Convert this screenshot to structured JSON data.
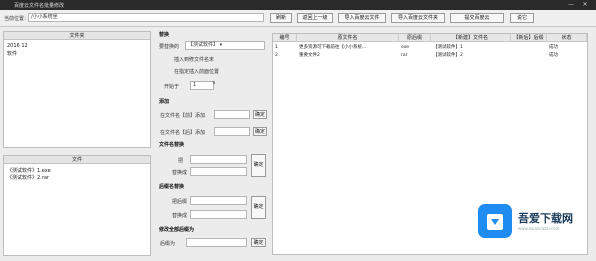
{
  "app": {
    "title": "百度云文件名批量修改"
  },
  "colors": {
    "titlebar": "#2a2a2a",
    "watermark_blue": "#1e8cf0"
  },
  "toolbar": {
    "path_label": "当前位置：",
    "path_value": "/小小系统坐",
    "btn_refresh": "刷新",
    "btn_back": "返回上一级",
    "btn_import_file": "导入百度云文件",
    "btn_import_folder": "导入百度云文件夹",
    "btn_confirm": "提交百度云",
    "btn_about": "说它"
  },
  "folders": {
    "header": "文件夹",
    "items": [
      "2016 12",
      "软件"
    ]
  },
  "files": {
    "header": "文件",
    "items": [
      "《测试软件》1.exe",
      "《测试软件》2.rar"
    ]
  },
  "ops": {
    "section_replace": "替换",
    "replace_mode_label": "要替换的",
    "replace_mode_value": "【测试软件】 ▾",
    "opt_insert_tail": "插入到修文件名末",
    "opt_insert_pos": "在指定插入前面位置",
    "count_label": "开始于",
    "count_value": "1",
    "section_add": "添加",
    "add_front_label": "在文件名【前】添加",
    "add_front_btn": "确定",
    "add_back_label": "在文件名【后】添加",
    "add_back_btn": "确定",
    "section_file_replace": "文件名替换",
    "fr_find_label": "把",
    "fr_replace_label": "替换成",
    "fr_btn": "确定",
    "section_ext_replace": "后缀名替换",
    "er_find_label": "把后缀",
    "er_replace_label": "替换成",
    "er_btn": "确定",
    "section_all": "修改全部后缀为",
    "all_label": "后缀为",
    "all_btn": "确定"
  },
  "table": {
    "columns": [
      "编号",
      "原文件名",
      "原后缀",
      "【新建】文件名",
      "【新后】后缀",
      "状态"
    ],
    "rows": [
      [
        "1",
        "更多资源可下载前往【小小系统...",
        "exe",
        "【测试软件】1",
        "",
        "成功"
      ],
      [
        "2",
        "重要文件2",
        "rar",
        "【测试软件】2",
        "",
        "成功"
      ]
    ]
  },
  "watermark": {
    "text": "吾爱下载网",
    "url": "www.wuaixiazai.com"
  }
}
